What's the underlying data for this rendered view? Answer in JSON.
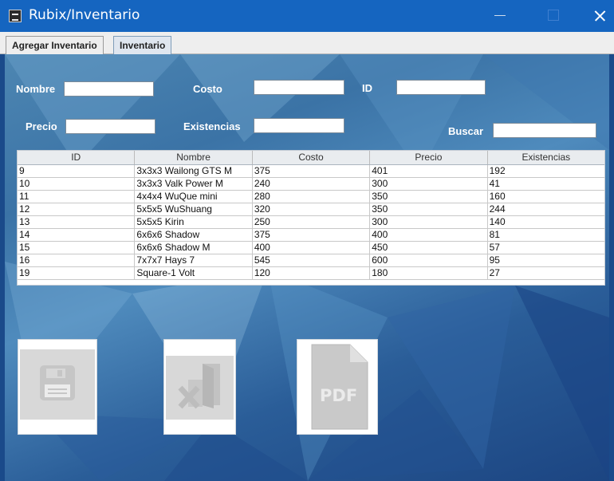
{
  "window": {
    "title": "Rubix/Inventario"
  },
  "tabs": [
    {
      "label": "Agregar Inventario",
      "active": false
    },
    {
      "label": "Inventario",
      "active": true
    }
  ],
  "form": {
    "nombre_label": "Nombre",
    "nombre_value": "",
    "costo_label": "Costo",
    "costo_value": "",
    "id_label": "ID",
    "id_value": "",
    "precio_label": "Precio",
    "precio_value": "",
    "existencias_label": "Existencias",
    "existencias_value": "",
    "buscar_label": "Buscar",
    "buscar_value": ""
  },
  "table": {
    "columns": [
      "ID",
      "Nombre",
      "Costo",
      "Precio",
      "Existencias"
    ],
    "rows": [
      [
        "9",
        "3x3x3 Wailong GTS M",
        "375",
        "401",
        "192"
      ],
      [
        "10",
        "3x3x3 Valk Power M",
        "240",
        "300",
        "41"
      ],
      [
        "11",
        "4x4x4 WuQue mini",
        "280",
        "350",
        "160"
      ],
      [
        "12",
        "5x5x5 WuShuang",
        "320",
        "350",
        "244"
      ],
      [
        "13",
        "5x5x5 Kirin",
        "250",
        "300",
        "140"
      ],
      [
        "14",
        "6x6x6 Shadow",
        "375",
        "400",
        "81"
      ],
      [
        "15",
        "6x6x6 Shadow M",
        "400",
        "450",
        "57"
      ],
      [
        "16",
        "7x7x7 Hays 7",
        "545",
        "600",
        "95"
      ],
      [
        "19",
        "Square-1 Volt",
        "120",
        "180",
        "27"
      ]
    ]
  },
  "actions": {
    "save_icon": "floppy-disk-icon",
    "delete_icon": "delete-file-icon",
    "pdf_icon": "pdf-file-icon",
    "pdf_text": "PDF"
  },
  "colors": {
    "titlebar": "#1565c0",
    "background": "#1a4a8a",
    "tab_active": "#dfe6ef"
  }
}
